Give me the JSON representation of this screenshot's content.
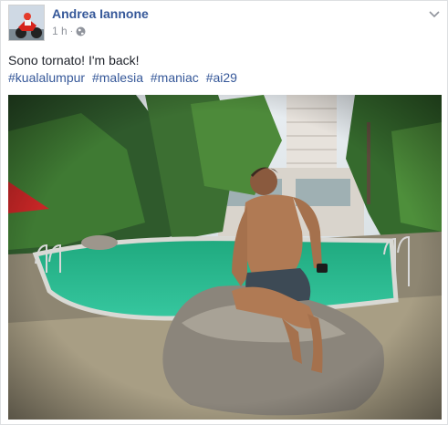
{
  "post": {
    "author": "Andrea Iannone",
    "timestamp": "1 h",
    "separator": "·",
    "privacy_icon": "globe-icon",
    "menu_icon": "chevron-down-icon",
    "text": "Sono tornato! I'm back!",
    "hashtags": [
      "#kualalumpur",
      "#malesia",
      "#maniac",
      "#ai29"
    ],
    "photo_icon": "photo-pool-scene"
  },
  "colors": {
    "link": "#365899",
    "meta": "#90949c",
    "text": "#1d2129",
    "pool": "#27b58f",
    "border": "#dddfe2"
  }
}
